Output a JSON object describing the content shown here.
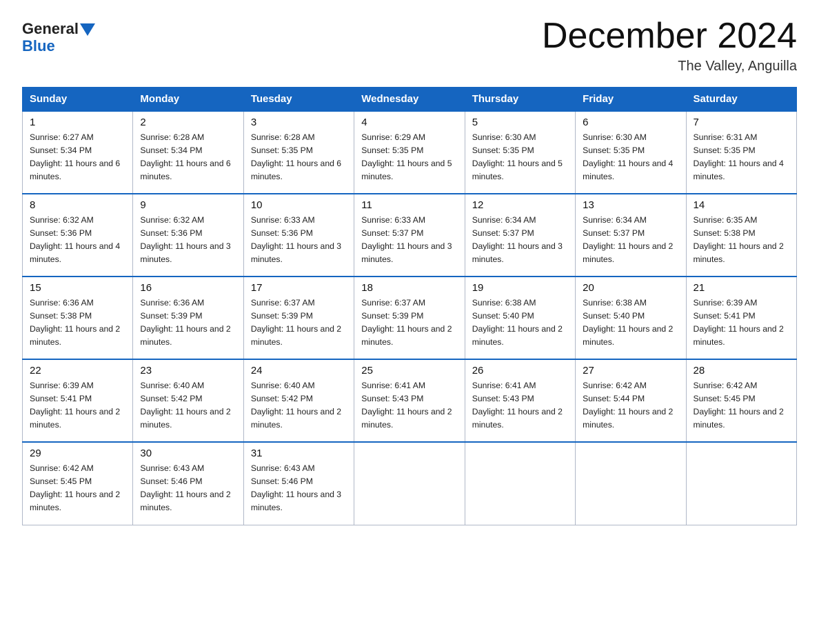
{
  "header": {
    "logo_general": "General",
    "logo_blue": "Blue",
    "month_title": "December 2024",
    "subtitle": "The Valley, Anguilla"
  },
  "weekdays": [
    "Sunday",
    "Monday",
    "Tuesday",
    "Wednesday",
    "Thursday",
    "Friday",
    "Saturday"
  ],
  "weeks": [
    [
      {
        "day": "1",
        "sunrise": "6:27 AM",
        "sunset": "5:34 PM",
        "daylight": "11 hours and 6 minutes."
      },
      {
        "day": "2",
        "sunrise": "6:28 AM",
        "sunset": "5:34 PM",
        "daylight": "11 hours and 6 minutes."
      },
      {
        "day": "3",
        "sunrise": "6:28 AM",
        "sunset": "5:35 PM",
        "daylight": "11 hours and 6 minutes."
      },
      {
        "day": "4",
        "sunrise": "6:29 AM",
        "sunset": "5:35 PM",
        "daylight": "11 hours and 5 minutes."
      },
      {
        "day": "5",
        "sunrise": "6:30 AM",
        "sunset": "5:35 PM",
        "daylight": "11 hours and 5 minutes."
      },
      {
        "day": "6",
        "sunrise": "6:30 AM",
        "sunset": "5:35 PM",
        "daylight": "11 hours and 4 minutes."
      },
      {
        "day": "7",
        "sunrise": "6:31 AM",
        "sunset": "5:35 PM",
        "daylight": "11 hours and 4 minutes."
      }
    ],
    [
      {
        "day": "8",
        "sunrise": "6:32 AM",
        "sunset": "5:36 PM",
        "daylight": "11 hours and 4 minutes."
      },
      {
        "day": "9",
        "sunrise": "6:32 AM",
        "sunset": "5:36 PM",
        "daylight": "11 hours and 3 minutes."
      },
      {
        "day": "10",
        "sunrise": "6:33 AM",
        "sunset": "5:36 PM",
        "daylight": "11 hours and 3 minutes."
      },
      {
        "day": "11",
        "sunrise": "6:33 AM",
        "sunset": "5:37 PM",
        "daylight": "11 hours and 3 minutes."
      },
      {
        "day": "12",
        "sunrise": "6:34 AM",
        "sunset": "5:37 PM",
        "daylight": "11 hours and 3 minutes."
      },
      {
        "day": "13",
        "sunrise": "6:34 AM",
        "sunset": "5:37 PM",
        "daylight": "11 hours and 2 minutes."
      },
      {
        "day": "14",
        "sunrise": "6:35 AM",
        "sunset": "5:38 PM",
        "daylight": "11 hours and 2 minutes."
      }
    ],
    [
      {
        "day": "15",
        "sunrise": "6:36 AM",
        "sunset": "5:38 PM",
        "daylight": "11 hours and 2 minutes."
      },
      {
        "day": "16",
        "sunrise": "6:36 AM",
        "sunset": "5:39 PM",
        "daylight": "11 hours and 2 minutes."
      },
      {
        "day": "17",
        "sunrise": "6:37 AM",
        "sunset": "5:39 PM",
        "daylight": "11 hours and 2 minutes."
      },
      {
        "day": "18",
        "sunrise": "6:37 AM",
        "sunset": "5:39 PM",
        "daylight": "11 hours and 2 minutes."
      },
      {
        "day": "19",
        "sunrise": "6:38 AM",
        "sunset": "5:40 PM",
        "daylight": "11 hours and 2 minutes."
      },
      {
        "day": "20",
        "sunrise": "6:38 AM",
        "sunset": "5:40 PM",
        "daylight": "11 hours and 2 minutes."
      },
      {
        "day": "21",
        "sunrise": "6:39 AM",
        "sunset": "5:41 PM",
        "daylight": "11 hours and 2 minutes."
      }
    ],
    [
      {
        "day": "22",
        "sunrise": "6:39 AM",
        "sunset": "5:41 PM",
        "daylight": "11 hours and 2 minutes."
      },
      {
        "day": "23",
        "sunrise": "6:40 AM",
        "sunset": "5:42 PM",
        "daylight": "11 hours and 2 minutes."
      },
      {
        "day": "24",
        "sunrise": "6:40 AM",
        "sunset": "5:42 PM",
        "daylight": "11 hours and 2 minutes."
      },
      {
        "day": "25",
        "sunrise": "6:41 AM",
        "sunset": "5:43 PM",
        "daylight": "11 hours and 2 minutes."
      },
      {
        "day": "26",
        "sunrise": "6:41 AM",
        "sunset": "5:43 PM",
        "daylight": "11 hours and 2 minutes."
      },
      {
        "day": "27",
        "sunrise": "6:42 AM",
        "sunset": "5:44 PM",
        "daylight": "11 hours and 2 minutes."
      },
      {
        "day": "28",
        "sunrise": "6:42 AM",
        "sunset": "5:45 PM",
        "daylight": "11 hours and 2 minutes."
      }
    ],
    [
      {
        "day": "29",
        "sunrise": "6:42 AM",
        "sunset": "5:45 PM",
        "daylight": "11 hours and 2 minutes."
      },
      {
        "day": "30",
        "sunrise": "6:43 AM",
        "sunset": "5:46 PM",
        "daylight": "11 hours and 2 minutes."
      },
      {
        "day": "31",
        "sunrise": "6:43 AM",
        "sunset": "5:46 PM",
        "daylight": "11 hours and 3 minutes."
      },
      null,
      null,
      null,
      null
    ]
  ]
}
